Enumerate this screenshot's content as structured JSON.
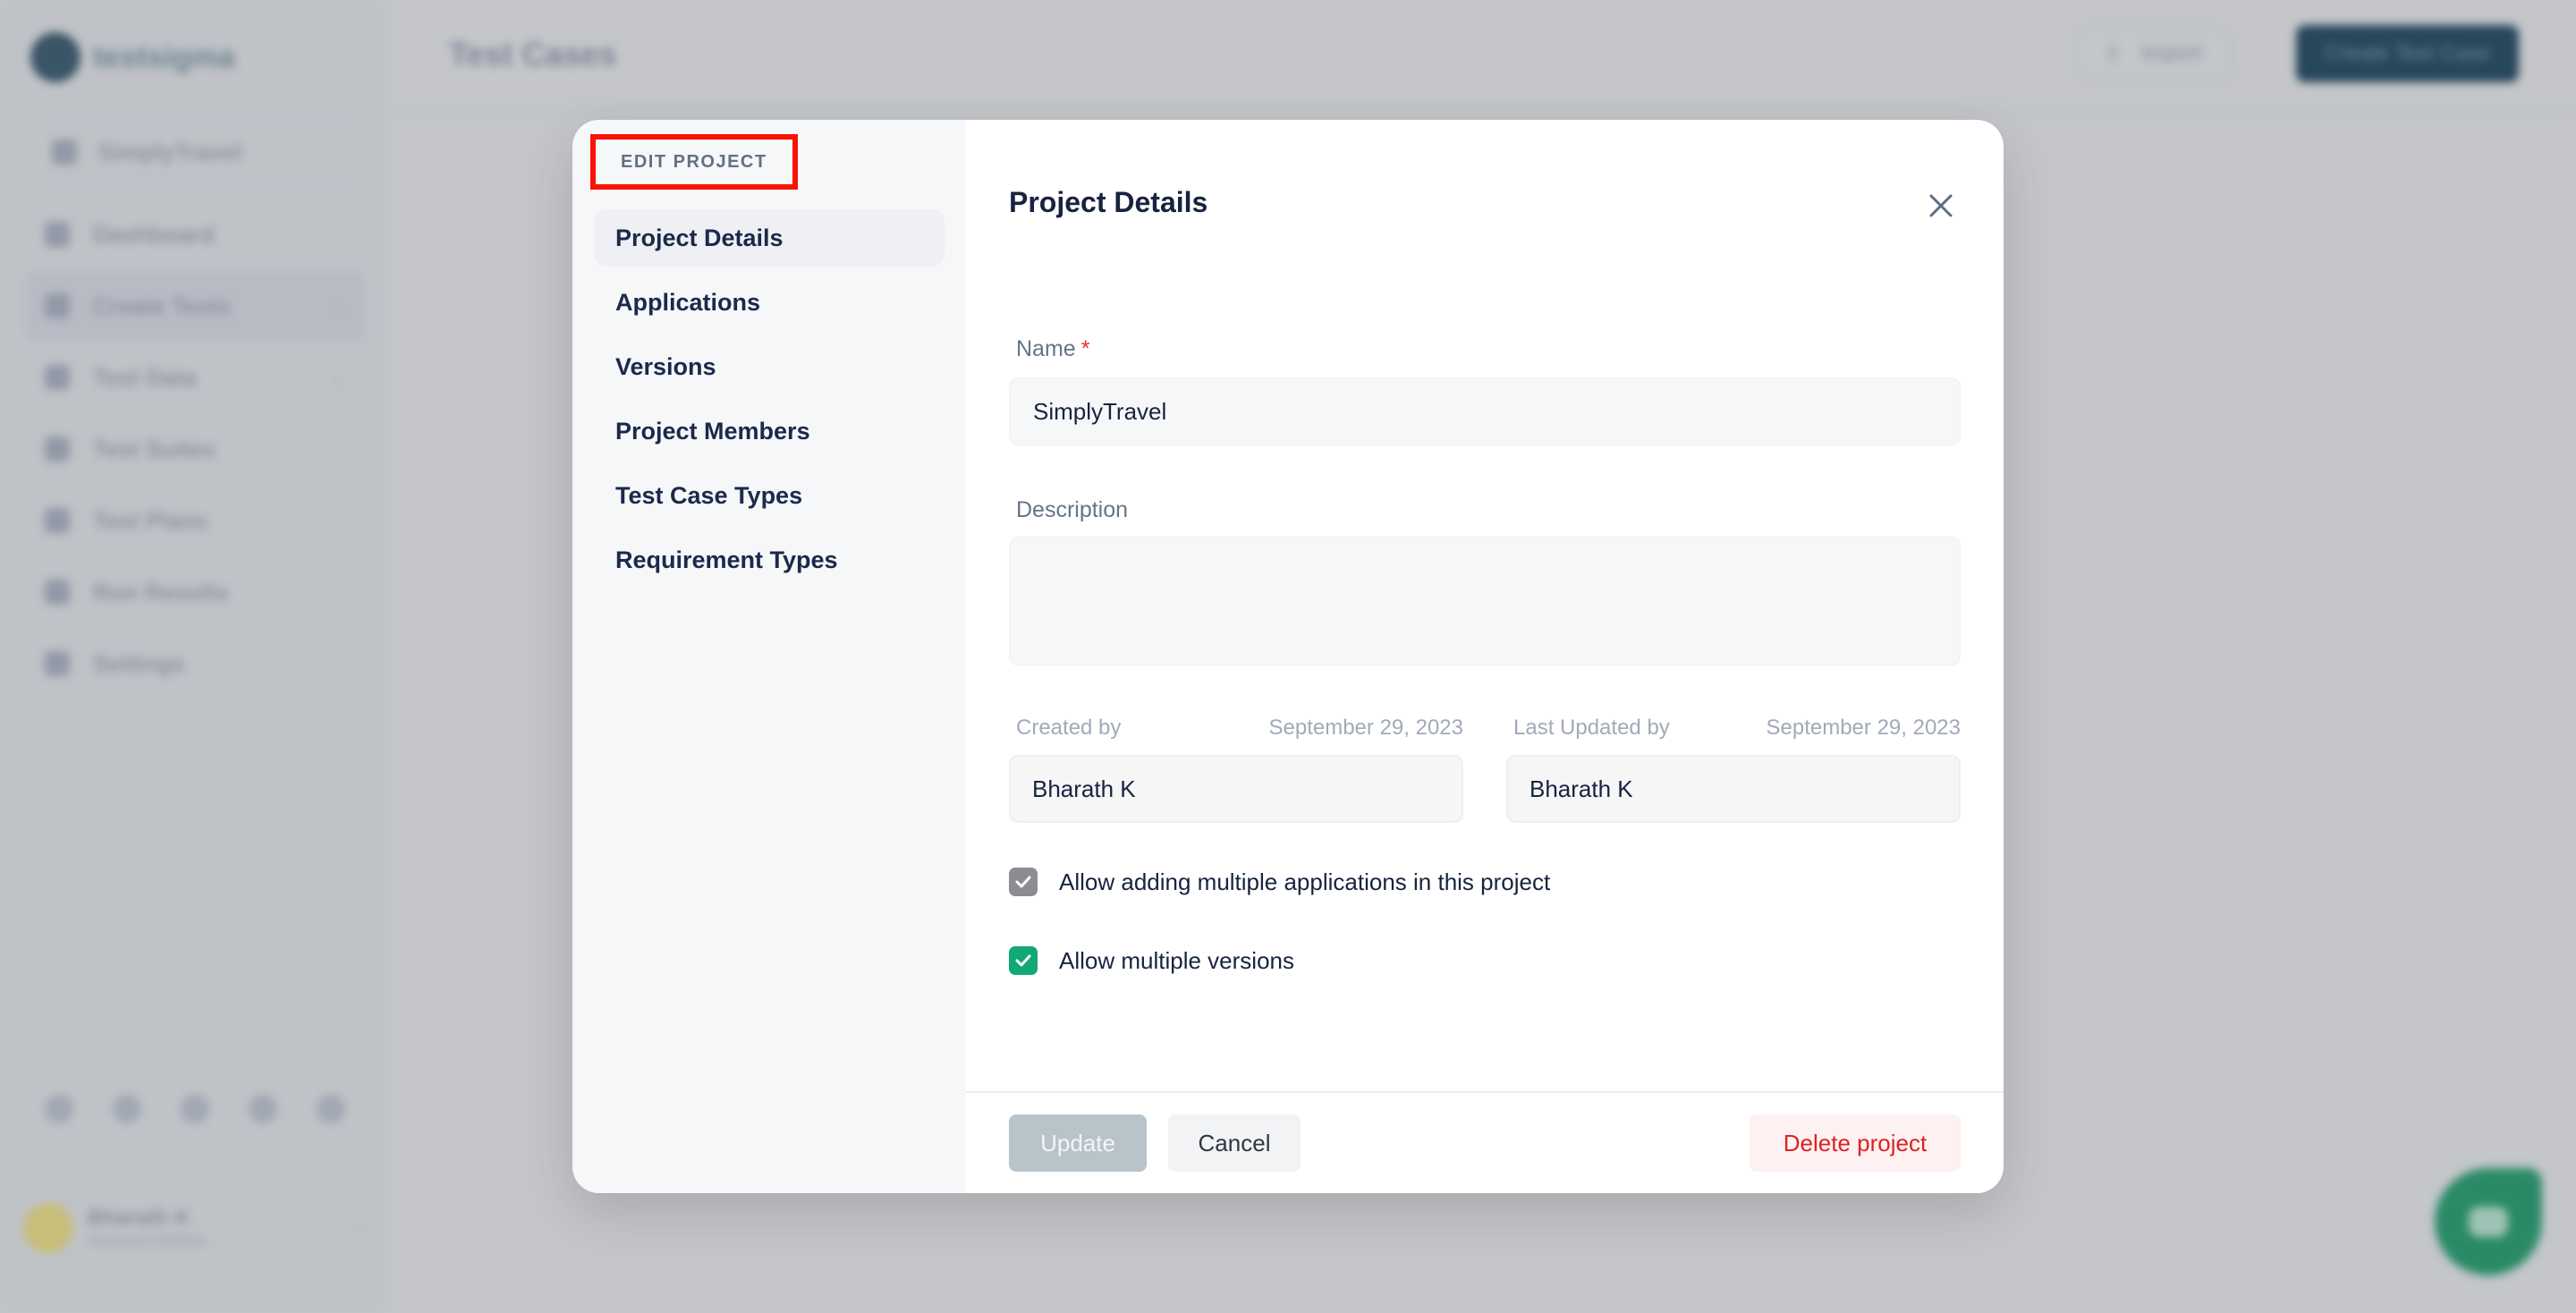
{
  "background": {
    "app_name": "testsigma",
    "project_switcher": "SimplyTravel",
    "nav": [
      {
        "label": "Dashboard",
        "icon": "home-icon",
        "has_chevron": false
      },
      {
        "label": "Create Tests",
        "icon": "pen-icon",
        "has_chevron": true
      },
      {
        "label": "Test Data",
        "icon": "table-icon",
        "has_chevron": true
      },
      {
        "label": "Test Suites",
        "icon": "grid-icon",
        "has_chevron": false
      },
      {
        "label": "Test Plans",
        "icon": "clock-icon",
        "has_chevron": false
      },
      {
        "label": "Run Results",
        "icon": "chart-icon",
        "has_chevron": false
      },
      {
        "label": "Settings",
        "icon": "gear-icon",
        "has_chevron": false
      }
    ],
    "user": {
      "name": "Bharath K",
      "subtitle": "Account Admin"
    },
    "page_title": "Test Cases",
    "import_label": "Import",
    "create_label": "Create Test Case"
  },
  "modal": {
    "section_label": "EDIT PROJECT",
    "nav": [
      {
        "label": "Project Details",
        "active": true
      },
      {
        "label": "Applications",
        "active": false
      },
      {
        "label": "Versions",
        "active": false
      },
      {
        "label": "Project Members",
        "active": false
      },
      {
        "label": "Test Case Types",
        "active": false
      },
      {
        "label": "Requirement Types",
        "active": false
      }
    ],
    "title": "Project Details",
    "name_label": "Name",
    "name_required_mark": "*",
    "name_value": "SimplyTravel",
    "description_label": "Description",
    "description_value": "",
    "created_by_label": "Created by",
    "created_date": "September 29, 2023",
    "created_by_value": "Bharath K",
    "updated_by_label": "Last Updated by",
    "updated_date": "September 29, 2023",
    "updated_by_value": "Bharath K",
    "checkboxes": [
      {
        "label": "Allow adding multiple applications in this project",
        "checked": true,
        "disabled": true
      },
      {
        "label": "Allow multiple versions",
        "checked": true,
        "disabled": false
      }
    ],
    "update_label": "Update",
    "cancel_label": "Cancel",
    "delete_label": "Delete project"
  },
  "colors": {
    "accent_green": "#12a873",
    "danger": "#dc2222",
    "highlight": "#fa1205",
    "brand_dark": "#27475a"
  }
}
